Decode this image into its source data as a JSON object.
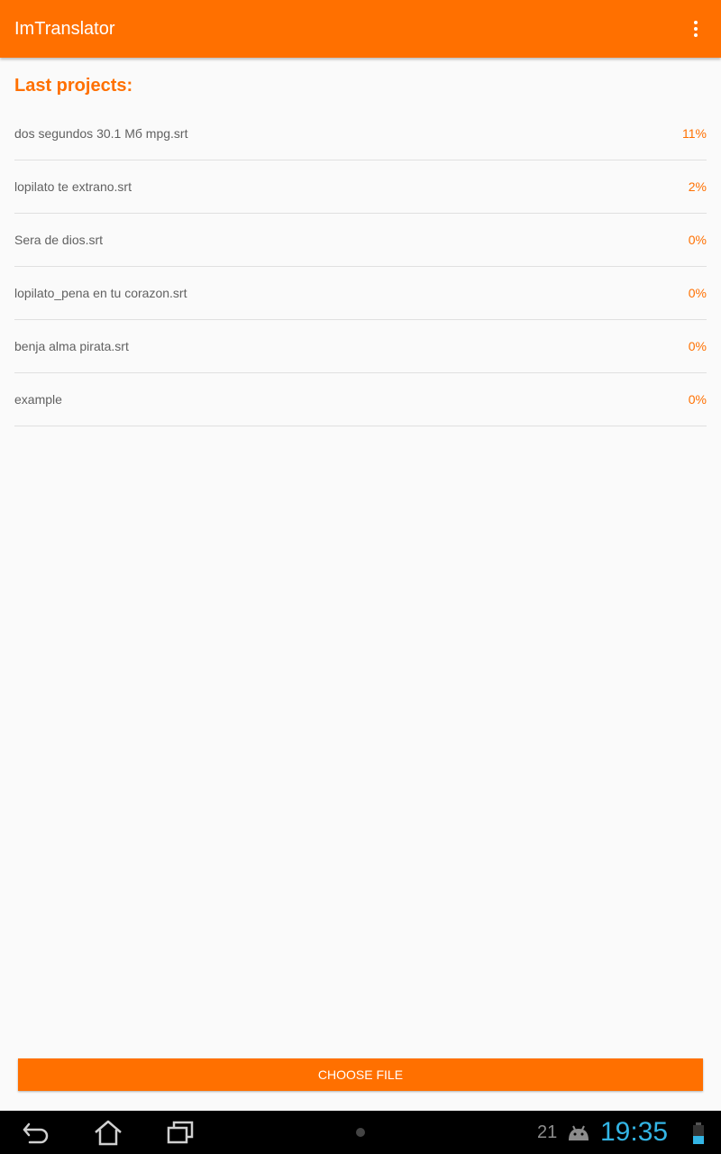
{
  "app": {
    "title": "ImTranslator",
    "accent_color": "#ff7000",
    "menu_icon": "overflow-menu-icon"
  },
  "section": {
    "title": "Last projects:"
  },
  "projects": [
    {
      "name": "dos segundos 30.1 Мб mpg.srt",
      "progress": "11%"
    },
    {
      "name": "lopilato te extrano.srt",
      "progress": "2%"
    },
    {
      "name": "Sera de dios.srt",
      "progress": "0%"
    },
    {
      "name": "lopilato_pena en tu corazon.srt",
      "progress": "0%"
    },
    {
      "name": "benja alma pirata.srt",
      "progress": "0%"
    },
    {
      "name": "example",
      "progress": "0%"
    }
  ],
  "actions": {
    "choose_file_label": "CHOOSE FILE"
  },
  "system_bar": {
    "nav_icons": [
      "back-icon",
      "home-icon",
      "recent-apps-icon"
    ],
    "notification_count": "21",
    "time": "19:35",
    "clock_color": "#33b5e5"
  }
}
